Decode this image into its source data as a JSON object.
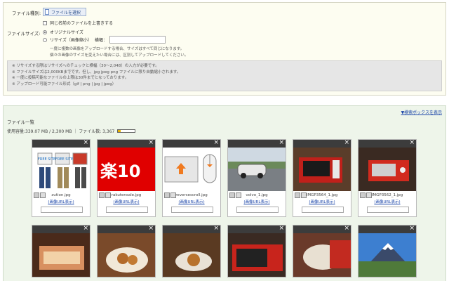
{
  "form": {
    "file_type_label": "ファイル種別:",
    "file_select_button": "ファイルを選択",
    "overwrite_label": "同じ名前のファイルを上書きする",
    "file_size_label": "ファイルサイズ:",
    "original_size_label": "オリジナルサイズ",
    "resize_label": "リサイズ（画像縮小）",
    "width_label": "横幅：",
    "note1": "一度に複数の画像をアップロードする場合、サイズはすべて同じになります。",
    "note2": "個々の画像のサイズを変えたい場合には、区別してアップロードしてください。"
  },
  "info": [
    "※ リサイズする際はリサイズへのチェックと横幅（30～2,048）の入力が必要です。",
    "※ ファイルサイズは2,000KBまでです。但し、jpg jpeg png ファイルに限り自動縮小されます。",
    "※ 一度に投稿可能なファイルの上限は30件までとなっております。",
    "※ アップロード可能ファイル形式（gif | png | jpg | jpeg）"
  ],
  "list": {
    "search_toggle": "▼検索ボックスを表示",
    "title": "ファイル一覧",
    "usage": "使用容量:339.07 MB / 2,300 MB ｜ ファイル数: 3,367",
    "usage_fraction": 0.15
  },
  "link_label": "(画像URL表示)",
  "files": [
    {
      "name": "zution.jpg"
    },
    {
      "name": "rakutensale.jpg"
    },
    {
      "name": "reversescroll.jpg"
    },
    {
      "name": "volvo_1.jpg"
    },
    {
      "name": "IMGP3564_1.jpg"
    },
    {
      "name": "IMGP3562_1.jpg"
    }
  ],
  "thumb_text": {
    "rakuten": "楽10",
    "free_site": "FREE SITE"
  },
  "colors": {
    "accent_link": "#1a44a8",
    "rakuten_red": "#e00000",
    "panel_list": "#eef5ea"
  }
}
